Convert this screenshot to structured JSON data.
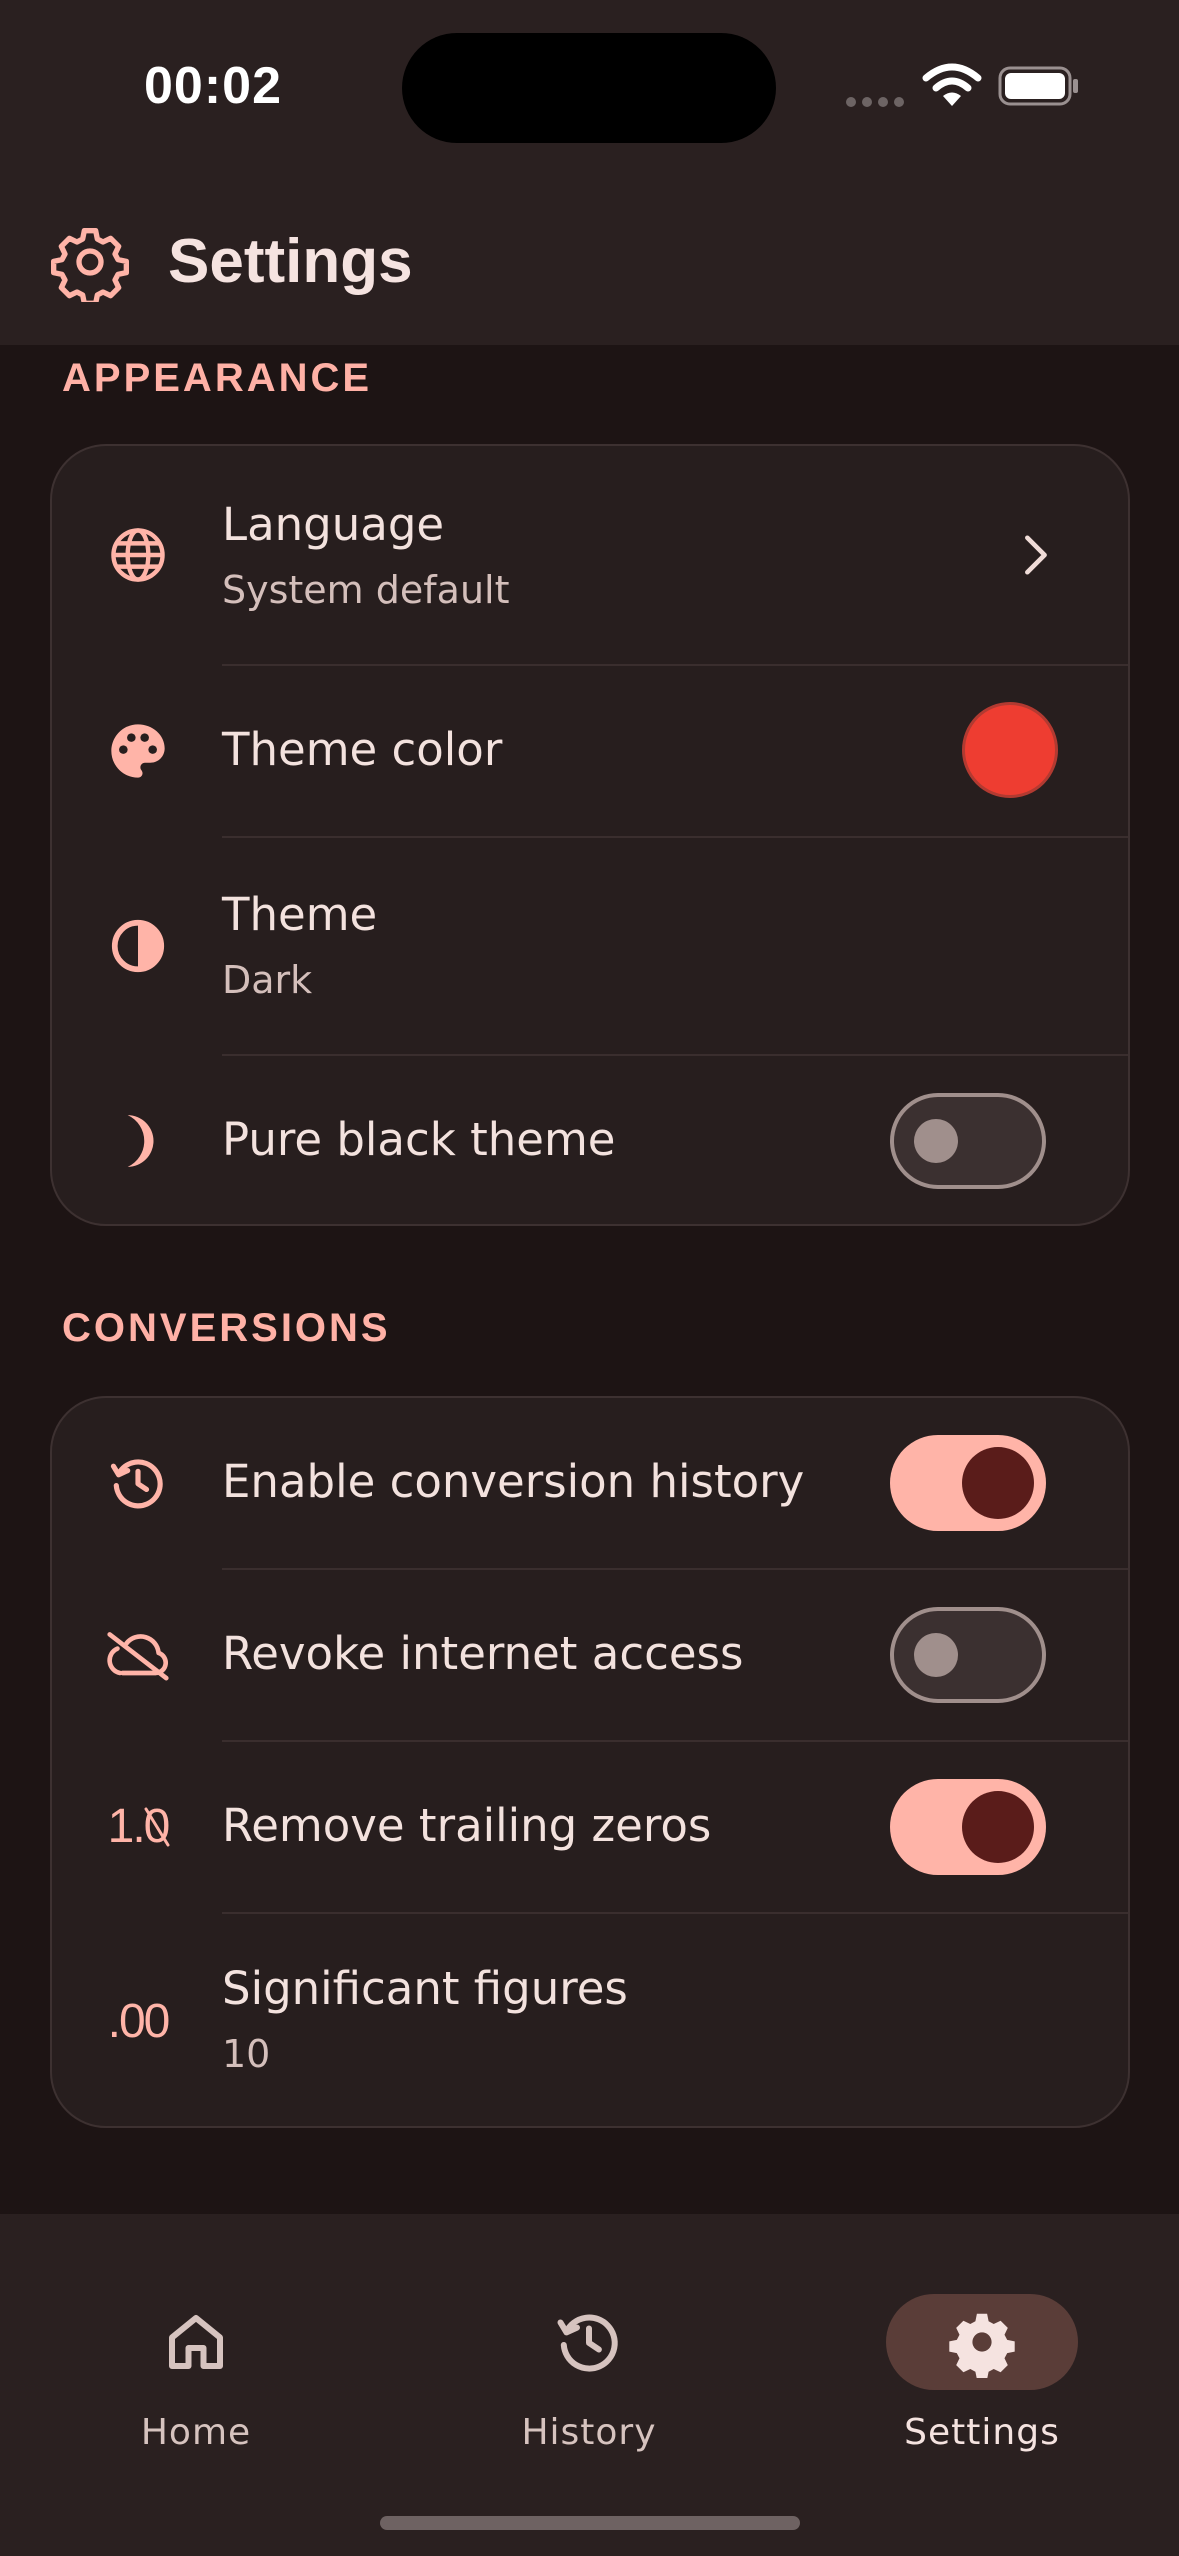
{
  "status_bar": {
    "time": "00:02"
  },
  "header": {
    "title": "Settings",
    "icon": "gear-icon"
  },
  "appearance": {
    "label": "APPEARANCE",
    "language": {
      "title": "Language",
      "subtitle": "System default",
      "icon": "globe-icon"
    },
    "theme_color": {
      "title": "Theme color",
      "icon": "palette-icon",
      "color": "#ee3d31"
    },
    "theme": {
      "title": "Theme",
      "subtitle": "Dark",
      "icon": "contrast-icon"
    },
    "pure_black": {
      "title": "Pure black theme",
      "icon": "moon-icon",
      "enabled": false
    }
  },
  "conversions": {
    "label": "CONVERSIONS",
    "history": {
      "title": "Enable conversion history",
      "icon": "history-icon",
      "enabled": true
    },
    "internet": {
      "title": "Revoke internet access",
      "icon": "cloud-off-icon",
      "enabled": false
    },
    "trailing_zeros": {
      "title": "Remove trailing zeros",
      "icon_text": "1.0",
      "enabled": true
    },
    "sig_figs": {
      "title": "Significant figures",
      "subtitle": "10",
      "icon_text": ".00"
    }
  },
  "nav": {
    "items": [
      {
        "label": "Home",
        "icon": "home-icon",
        "active": false
      },
      {
        "label": "History",
        "icon": "history-icon",
        "active": false
      },
      {
        "label": "Settings",
        "icon": "gear-icon",
        "active": true
      }
    ]
  },
  "colors": {
    "accent": "#ffb4a8",
    "background": "#1d1414",
    "surface": "#271e1e",
    "bar": "#2a2020"
  }
}
